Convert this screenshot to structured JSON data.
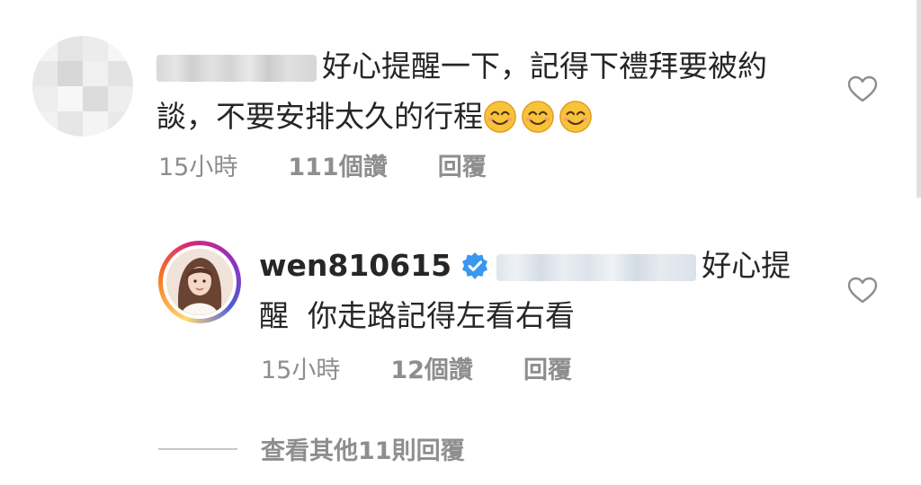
{
  "comments": [
    {
      "line1": "好心提醒一下，記得下禮拜要被約",
      "line2": "談，不要安排太久的行程",
      "time": "15小時",
      "likes": "111個讚",
      "reply_label": "回覆"
    },
    {
      "username": "wen810615",
      "line1": "好心提",
      "line2": "醒  你走路記得左看右看",
      "time": "15小時",
      "likes": "12個讚",
      "reply_label": "回覆"
    }
  ],
  "view_more": "查看其他11則回覆",
  "colors": {
    "text": "#262626",
    "secondary": "#8e8e8e",
    "verified": "#3897f0",
    "heart_outline": "#8e8e8e"
  },
  "icons": {
    "like": "heart-outline-icon",
    "verified": "verified-badge-icon",
    "emoji": "smiling-face-emoji"
  }
}
